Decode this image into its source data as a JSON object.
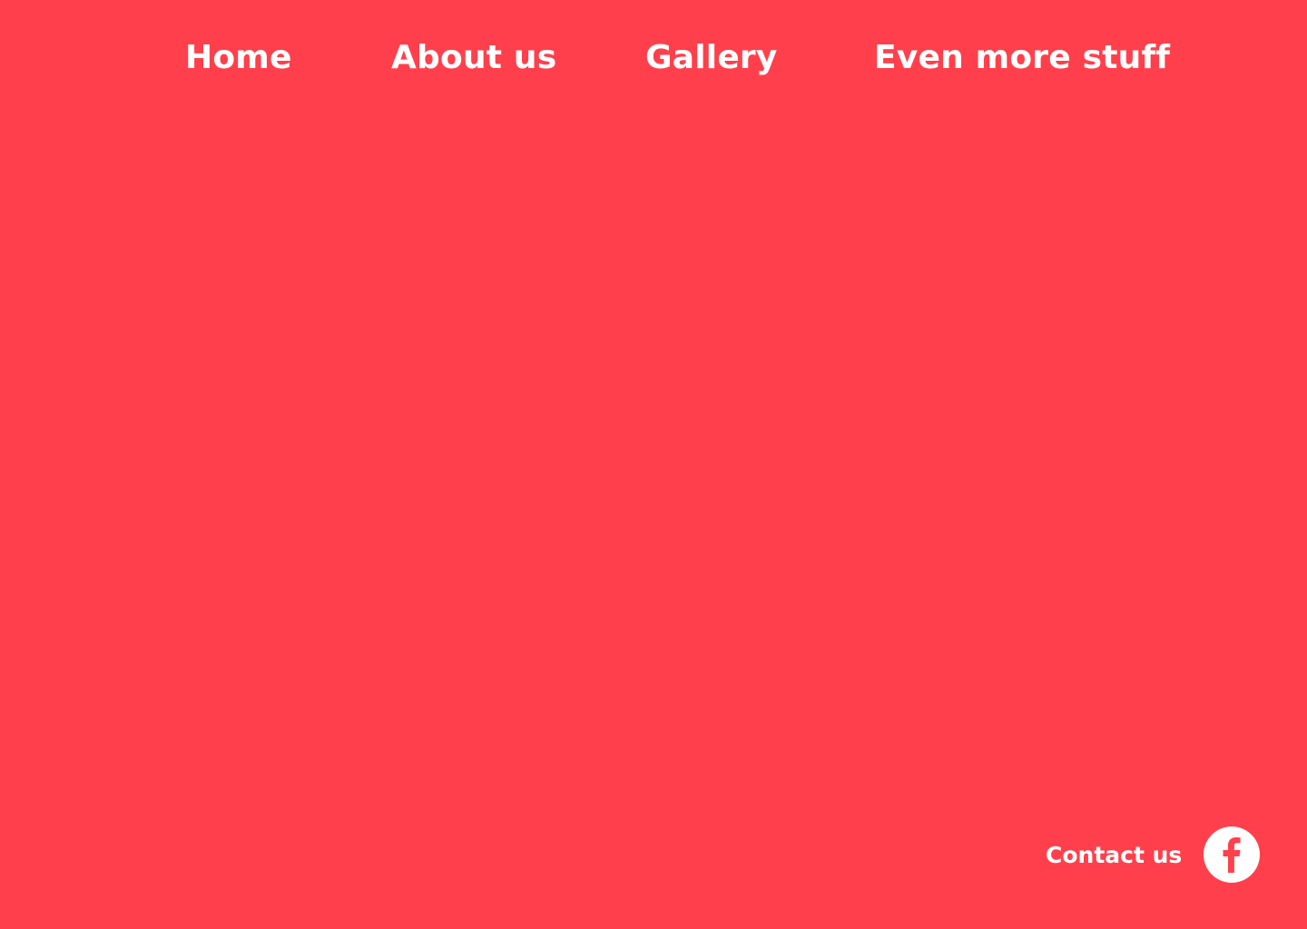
{
  "theme": {
    "background": "#FF404C",
    "text": "#FFFFFF",
    "icon_circle": "#FFFFFF"
  },
  "nav": {
    "items": [
      {
        "label": "Home"
      },
      {
        "label": "About us"
      },
      {
        "label": "Gallery"
      },
      {
        "label": "Even more stuff"
      }
    ]
  },
  "footer": {
    "contact_label": "Contact us",
    "social_icon": "facebook-icon"
  }
}
